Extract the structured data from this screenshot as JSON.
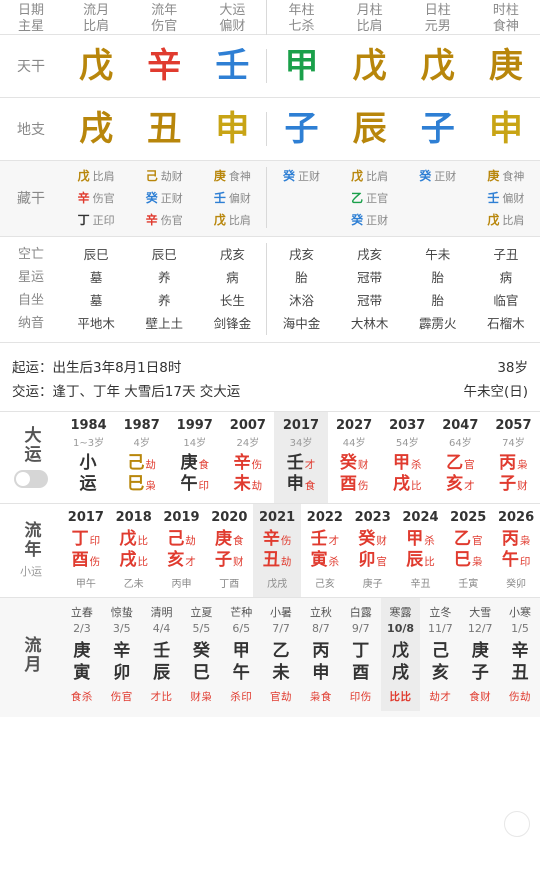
{
  "top": {
    "row_labels": {
      "tiangan": "天干",
      "dizhi": "地支",
      "canggan": "藏干",
      "kongwang": "空亡",
      "xingyun": "星运",
      "zizuo": "自坐",
      "nayin": "纳音"
    },
    "headers": [
      {
        "t1": "日期",
        "t2": "主星"
      },
      {
        "t1": "流月",
        "t2": "比肩"
      },
      {
        "t1": "流年",
        "t2": "伤官"
      },
      {
        "t1": "大运",
        "t2": "偏财"
      },
      {
        "t1": "年柱",
        "t2": "七杀"
      },
      {
        "t1": "月柱",
        "t2": "比肩"
      },
      {
        "t1": "日柱",
        "t2": "元男"
      },
      {
        "t1": "时柱",
        "t2": "食神"
      }
    ],
    "tiangan": [
      {
        "char": "戊",
        "color": "earth"
      },
      {
        "char": "辛",
        "color": "metal"
      },
      {
        "char": "壬",
        "color": "water"
      },
      {
        "char": "甲",
        "color": "wood"
      },
      {
        "char": "戊",
        "color": "earth"
      },
      {
        "char": "戊",
        "color": "earth"
      },
      {
        "char": "庚",
        "color": "metal"
      }
    ],
    "dizhi": [
      {
        "char": "戌",
        "color": "earth"
      },
      {
        "char": "丑",
        "color": "earth"
      },
      {
        "char": "申",
        "color": "metal"
      },
      {
        "char": "子",
        "color": "water"
      },
      {
        "char": "辰",
        "color": "earth"
      },
      {
        "char": "子",
        "color": "water"
      },
      {
        "char": "申",
        "color": "metal"
      }
    ],
    "canggan": [
      [
        {
          "g": "戊",
          "c": "earth",
          "n": "比肩"
        },
        {
          "g": "辛",
          "c": "metal",
          "n": "伤官"
        },
        {
          "g": "丁",
          "c": "fire",
          "n": "正印"
        }
      ],
      [
        {
          "g": "己",
          "c": "earth",
          "n": "劫财"
        },
        {
          "g": "癸",
          "c": "water",
          "n": "正财"
        },
        {
          "g": "辛",
          "c": "metal",
          "n": "伤官"
        }
      ],
      [
        {
          "g": "庚",
          "c": "metal",
          "n": "食神"
        },
        {
          "g": "壬",
          "c": "water",
          "n": "偏财"
        },
        {
          "g": "戊",
          "c": "earth",
          "n": "比肩"
        }
      ],
      [
        {
          "g": "癸",
          "c": "water",
          "n": "正财"
        }
      ],
      [
        {
          "g": "戊",
          "c": "earth",
          "n": "比肩"
        },
        {
          "g": "乙",
          "c": "wood",
          "n": "正官"
        },
        {
          "g": "癸",
          "c": "water",
          "n": "正财"
        }
      ],
      [
        {
          "g": "癸",
          "c": "water",
          "n": "正财"
        }
      ],
      [
        {
          "g": "庚",
          "c": "metal",
          "n": "食神"
        },
        {
          "g": "壬",
          "c": "water",
          "n": "偏财"
        },
        {
          "g": "戊",
          "c": "earth",
          "n": "比肩"
        }
      ]
    ],
    "kongwang": [
      "辰巳",
      "辰巳",
      "戌亥",
      "戌亥",
      "戌亥",
      "午未",
      "子丑"
    ],
    "xingyun": [
      "墓",
      "养",
      "病",
      "胎",
      "冠带",
      "胎",
      "病"
    ],
    "zizuo": [
      "墓",
      "养",
      "长生",
      "沐浴",
      "冠带",
      "胎",
      "临官"
    ],
    "nayin": [
      "平地木",
      "壁上土",
      "剑锋金",
      "海中金",
      "大林木",
      "霹雳火",
      "石榴木"
    ]
  },
  "startluck": {
    "line1_key": "起运：",
    "line1_val": "出生后3年8月1日8时",
    "line1_right": "38岁",
    "line2_key": "交运：",
    "line2_val": "逢丁、丁年 大雪后17天 交大运",
    "line2_right": "午未空(日)"
  },
  "dayun": {
    "label": "大运",
    "cells": [
      {
        "year": "1984",
        "age": "1~3岁",
        "g": "小",
        "gc": "black",
        "gt": "",
        "z": "运",
        "zc": "black",
        "zt": "",
        "sel": false
      },
      {
        "year": "1987",
        "age": "4岁",
        "g": "己",
        "gc": "earth",
        "gt": "劫",
        "z": "巳",
        "zc": "earth",
        "zt": "枭",
        "sel": false
      },
      {
        "year": "1997",
        "age": "14岁",
        "g": "庚",
        "gc": "metal",
        "gt": "食",
        "z": "午",
        "zc": "metal",
        "zt": "印",
        "sel": false
      },
      {
        "year": "2007",
        "age": "24岁",
        "g": "辛",
        "gc": "fire",
        "gt": "伤",
        "z": "未",
        "zc": "fire",
        "zt": "劫",
        "sel": false
      },
      {
        "year": "2017",
        "age": "34岁",
        "g": "壬",
        "gc": "black",
        "gt": "才",
        "z": "申",
        "zc": "black",
        "zt": "食",
        "sel": true
      },
      {
        "year": "2027",
        "age": "44岁",
        "g": "癸",
        "gc": "fire",
        "gt": "财",
        "z": "酉",
        "zc": "fire",
        "zt": "伤",
        "sel": false
      },
      {
        "year": "2037",
        "age": "54岁",
        "g": "甲",
        "gc": "fire",
        "gt": "杀",
        "z": "戌",
        "zc": "fire",
        "zt": "比",
        "sel": false
      },
      {
        "year": "2047",
        "age": "64岁",
        "g": "乙",
        "gc": "fire",
        "gt": "官",
        "z": "亥",
        "zc": "fire",
        "zt": "才",
        "sel": false
      },
      {
        "year": "2057",
        "age": "74岁",
        "g": "丙",
        "gc": "fire",
        "gt": "枭",
        "z": "子",
        "zc": "fire",
        "zt": "财",
        "sel": false
      }
    ]
  },
  "liunian": {
    "label": "流年",
    "sub": "小运",
    "cells": [
      {
        "year": "2017",
        "g": "丁",
        "gt": "印",
        "z": "酉",
        "zt": "伤",
        "sub": "甲午",
        "sel": false
      },
      {
        "year": "2018",
        "g": "戊",
        "gt": "比",
        "z": "戌",
        "zt": "比",
        "sub": "乙未",
        "sel": false
      },
      {
        "year": "2019",
        "g": "己",
        "gt": "劫",
        "z": "亥",
        "zt": "才",
        "sub": "丙申",
        "sel": false
      },
      {
        "year": "2020",
        "g": "庚",
        "gt": "食",
        "z": "子",
        "zt": "财",
        "sub": "丁酉",
        "sel": false
      },
      {
        "year": "2021",
        "g": "辛",
        "gt": "伤",
        "z": "丑",
        "zt": "劫",
        "sub": "戊戌",
        "sel": true
      },
      {
        "year": "2022",
        "g": "壬",
        "gt": "才",
        "z": "寅",
        "zt": "杀",
        "sub": "己亥",
        "sel": false
      },
      {
        "year": "2023",
        "g": "癸",
        "gt": "财",
        "z": "卯",
        "zt": "官",
        "sub": "庚子",
        "sel": false
      },
      {
        "year": "2024",
        "g": "甲",
        "gt": "杀",
        "z": "辰",
        "zt": "比",
        "sub": "辛丑",
        "sel": false
      },
      {
        "year": "2025",
        "g": "乙",
        "gt": "官",
        "z": "巳",
        "zt": "枭",
        "sub": "壬寅",
        "sel": false
      },
      {
        "year": "2026",
        "g": "丙",
        "gt": "枭",
        "z": "午",
        "zt": "印",
        "sub": "癸卯",
        "sel": false
      }
    ]
  },
  "liuyue": {
    "label": "流月",
    "cells": [
      {
        "term": "立春",
        "date": "2/3",
        "g": "庚",
        "z": "寅",
        "ten": "食杀",
        "sel": false
      },
      {
        "term": "惊蛰",
        "date": "3/5",
        "g": "辛",
        "z": "卯",
        "ten": "伤官",
        "sel": false
      },
      {
        "term": "清明",
        "date": "4/4",
        "g": "壬",
        "z": "辰",
        "ten": "才比",
        "sel": false
      },
      {
        "term": "立夏",
        "date": "5/5",
        "g": "癸",
        "z": "巳",
        "ten": "财枭",
        "sel": false
      },
      {
        "term": "芒种",
        "date": "6/5",
        "g": "甲",
        "z": "午",
        "ten": "杀印",
        "sel": false
      },
      {
        "term": "小暑",
        "date": "7/7",
        "g": "乙",
        "z": "未",
        "ten": "官劫",
        "sel": false
      },
      {
        "term": "立秋",
        "date": "8/7",
        "g": "丙",
        "z": "申",
        "ten": "枭食",
        "sel": false
      },
      {
        "term": "白露",
        "date": "9/7",
        "g": "丁",
        "z": "酉",
        "ten": "印伤",
        "sel": false
      },
      {
        "term": "寒露",
        "date": "10/8",
        "g": "戊",
        "z": "戌",
        "ten": "比比",
        "sel": true
      },
      {
        "term": "立冬",
        "date": "11/7",
        "g": "己",
        "z": "亥",
        "ten": "劫才",
        "sel": false
      },
      {
        "term": "大雪",
        "date": "12/7",
        "g": "庚",
        "z": "子",
        "ten": "食财",
        "sel": false
      },
      {
        "term": "小寒",
        "date": "1/5",
        "g": "辛",
        "z": "丑",
        "ten": "伤劫",
        "sel": false
      }
    ]
  }
}
